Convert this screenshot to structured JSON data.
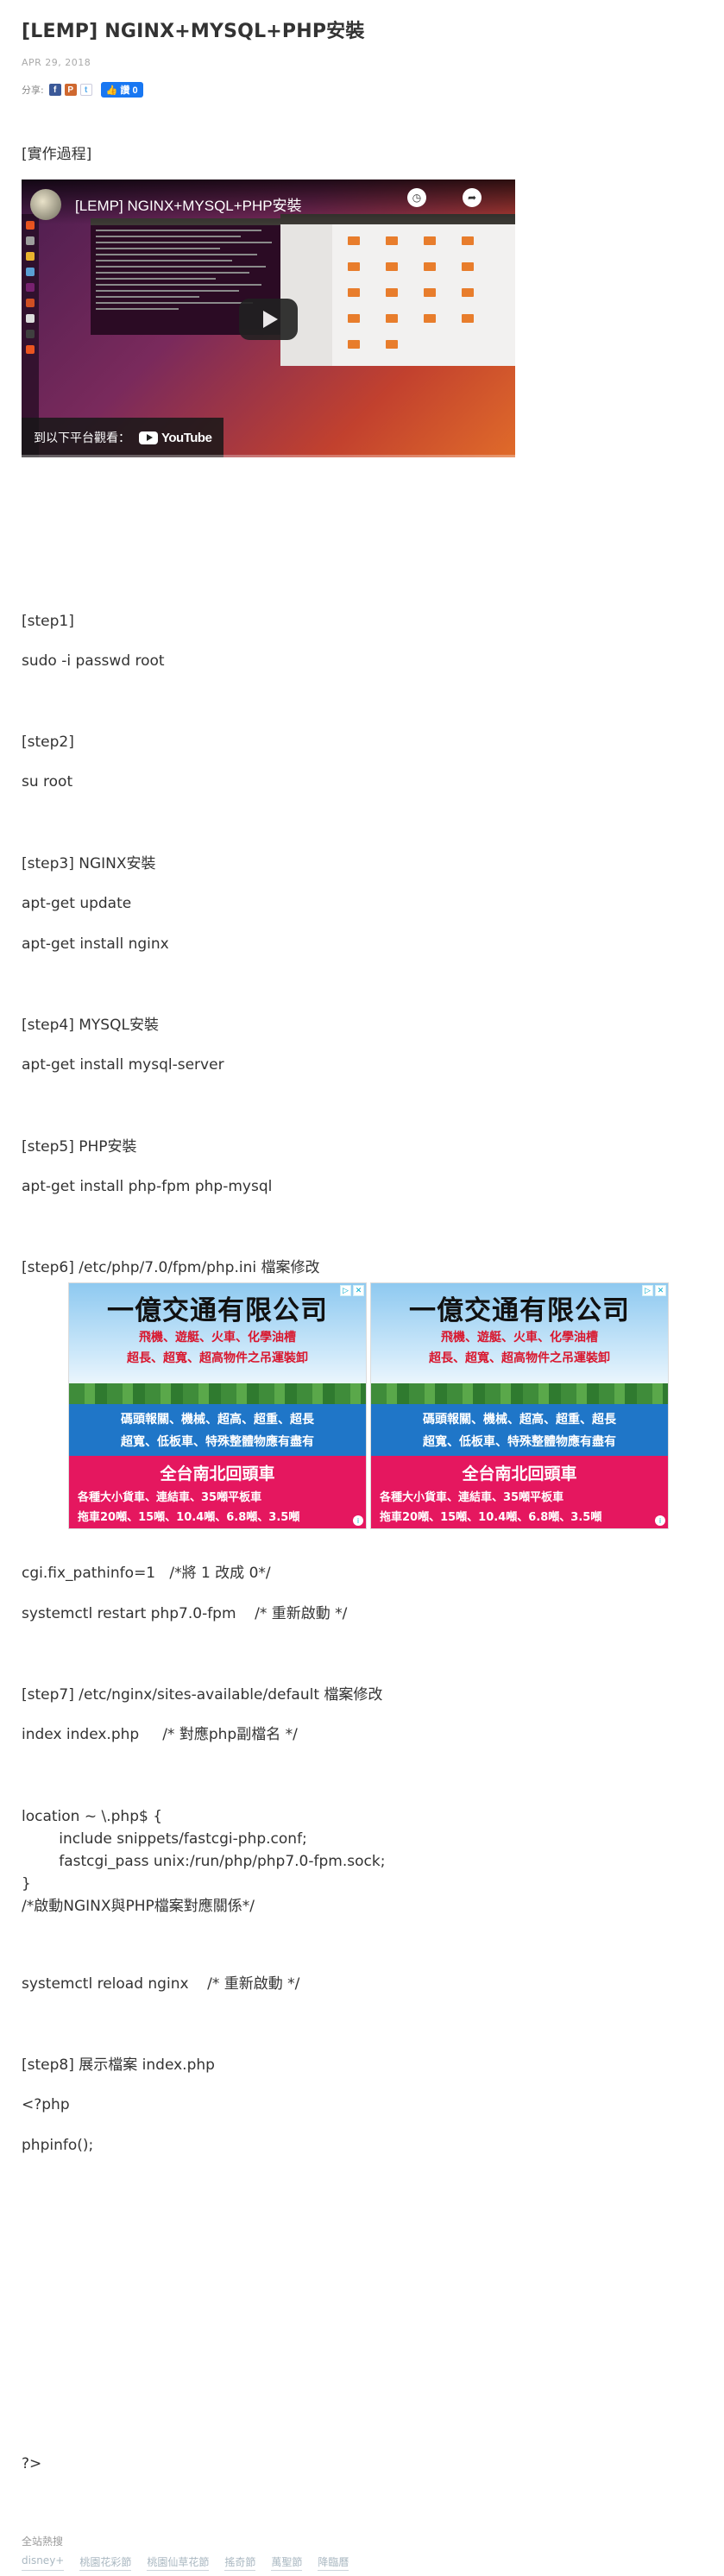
{
  "post": {
    "title": "[LEMP] NGINX+MYSQL+PHP安裝",
    "date": "APR 29, 2018",
    "share_label": "分享:",
    "share_icons": [
      "facebook-icon",
      "plurk-icon",
      "twitter-icon"
    ],
    "like_button": {
      "label": "讚 0"
    }
  },
  "video": {
    "title": "[LEMP] NGINX+MYSQL+PHP安裝",
    "watch_on": "到以下平台觀看：",
    "platform": "YouTube"
  },
  "content": {
    "intro": "[實作過程]",
    "step1_heading": "[step1]",
    "step1_cmd": "sudo -i passwd root",
    "step2_heading": "[step2]",
    "step2_cmd": "su root",
    "step3_heading": "[step3] NGINX安裝",
    "step3_cmd1": "apt-get update",
    "step3_cmd2": "apt-get install nginx",
    "step4_heading": "[step4] MYSQL安裝",
    "step4_cmd": "apt-get install mysql-server",
    "step5_heading": "[step5] PHP安裝",
    "step5_cmd": "apt-get install php-fpm php-mysql",
    "step6_heading": "[step6] /etc/php/7.0/fpm/php.ini 檔案修改",
    "step6_line1": "cgi.fix_pathinfo=1   /*將 1 改成 0*/",
    "step6_line2": "systemctl restart php7.0-fpm    /* 重新啟動 */",
    "step7_heading": "[step7] /etc/nginx/sites-available/default 檔案修改",
    "step7_line1": "index index.php     /* 對應php副檔名 */",
    "step7_block": "location ~ \\.php$ {\n        include snippets/fastcgi-php.conf;\n        fastcgi_pass unix:/run/php/php7.0-fpm.sock;\n}\n/*啟動NGINX與PHP檔案對應關係*/",
    "step7_line2": "systemctl reload nginx    /* 重新啟動 */",
    "step8_heading": "[step8] 展示檔案 index.php",
    "step8_line1": "<?php",
    "step8_line2": "phpinfo();",
    "step8_line3": "?>"
  },
  "ads": [
    {
      "company": "一億交通有限公司",
      "line1": "飛機、遊艇、火車、化學油槽",
      "line2": "超長、超寬、超高物件之吊運裝卸",
      "blue1": "碼頭報關、機械、超高、超重、超長",
      "blue2": "超寬、低板車、特殊整體物應有盡有",
      "pink_title": "全台南北回頭車",
      "pink1": "各種大小貨車、連結車、35噸平板車",
      "pink2": "拖車20噸、15噸、10.4噸、6.8噸、3.5噸"
    },
    {
      "company": "一億交通有限公司",
      "line1": "飛機、遊艇、火車、化學油槽",
      "line2": "超長、超寬、超高物件之吊運裝卸",
      "blue1": "碼頭報關、機械、超高、超重、超長",
      "blue2": "超寬、低板車、特殊整體物應有盡有",
      "pink_title": "全台南北回頭車",
      "pink1": "各種大小貨車、連結車、35噸平板車",
      "pink2": "拖車20噸、15噸、10.4噸、6.8噸、3.5噸"
    }
  ],
  "footer": {
    "label": "全站熱搜",
    "links": [
      "disney+",
      "桃園花彩節",
      "桃園仙草花節",
      "搖奇節",
      "萬聖節",
      "降臨曆"
    ]
  }
}
